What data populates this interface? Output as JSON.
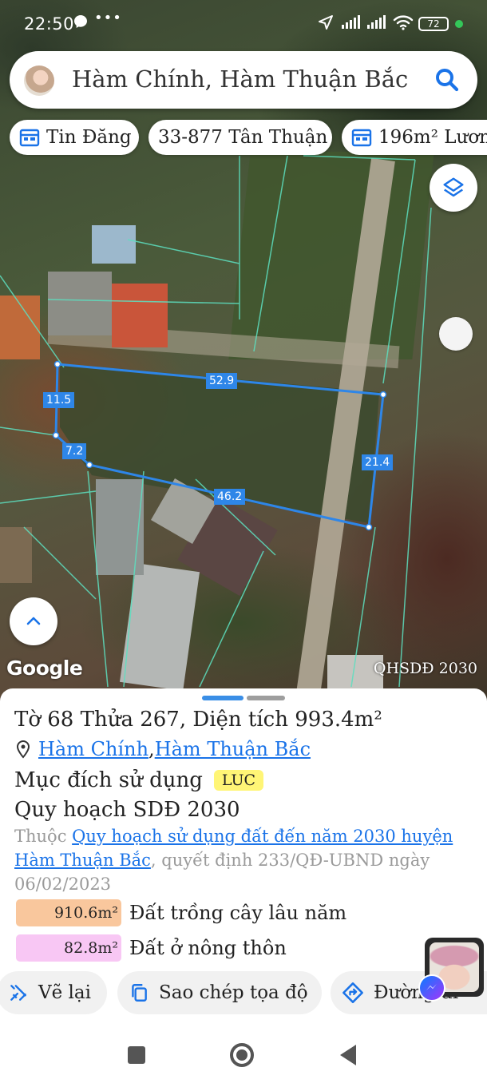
{
  "status_bar": {
    "time": "22:50",
    "battery": "72",
    "icons": [
      "messenger-icon",
      "more-dots-icon",
      "location-arrow-icon",
      "signal-icon",
      "signal-icon",
      "wifi-icon",
      "battery-icon"
    ]
  },
  "search": {
    "text": "Hàm Chính, Hàm Thuận Bắc",
    "icon": "search-icon"
  },
  "chips": [
    {
      "label": "Tin Đăng",
      "icon": "calendar-icon"
    },
    {
      "label": "33-877 Tân Thuận",
      "icon": ""
    },
    {
      "label": "196m² Lươn",
      "icon": "calendar-icon"
    }
  ],
  "map": {
    "attribution": "Google",
    "overlay_label": "QHSDĐ 2030",
    "measurements": [
      "52.9",
      "11.5",
      "7.2",
      "21.4",
      "46.2"
    ],
    "accent_color": "#2e86e8"
  },
  "parcel": {
    "title": "Tờ 68 Thửa 267, Diện tích 993.4m²",
    "location_commune": "Hàm Chính",
    "location_separator": ", ",
    "location_district": "Hàm Thuận Bắc",
    "purpose_label": "Mục đích sử dụng",
    "purpose_code": "LUC",
    "plan_title": "Quy hoạch SDĐ 2030",
    "plan_prefix": "Thuộc ",
    "plan_link": "Quy hoạch sử dụng đất đến năm 2030 huyện Hàm Thuận Bắc",
    "plan_suffix": ", quyết định 233/QĐ-UBND ngày 06/02/2023",
    "areas": [
      {
        "value": "910.6m²",
        "label": "Đất trồng cây lâu năm",
        "color": "#f9c79d"
      },
      {
        "value": "82.8m²",
        "label": "Đất ở nông thôn",
        "color": "#f8c7f4"
      }
    ]
  },
  "actions": [
    {
      "label": "Vẽ lại",
      "icon": "redraw-icon"
    },
    {
      "label": "Sao chép tọa độ",
      "icon": "copy-icon"
    },
    {
      "label": "Đường đi",
      "icon": "directions-icon"
    }
  ]
}
